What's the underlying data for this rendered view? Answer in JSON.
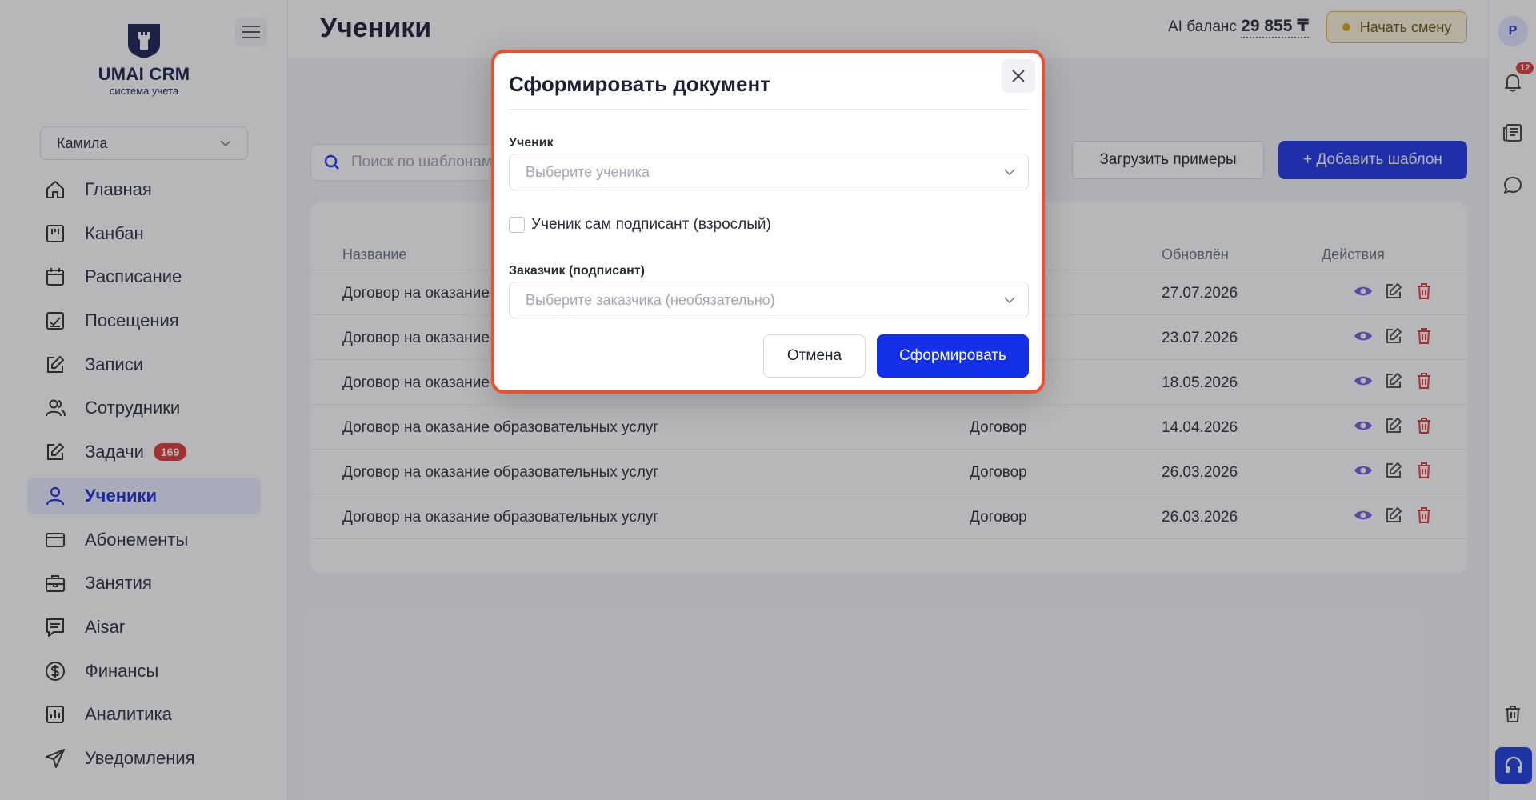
{
  "sidebar": {
    "logo_title": "UMAI CRM",
    "logo_subtitle": "система учета",
    "user": "Камила",
    "items": [
      {
        "label": "Главная",
        "icon": "home-icon"
      },
      {
        "label": "Канбан",
        "icon": "kanban-icon"
      },
      {
        "label": "Расписание",
        "icon": "calendar-icon"
      },
      {
        "label": "Посещения",
        "icon": "chart-check-icon"
      },
      {
        "label": "Записи",
        "icon": "edit-icon"
      },
      {
        "label": "Сотрудники",
        "icon": "users-icon"
      },
      {
        "label": "Задачи",
        "icon": "tasks-icon",
        "badge": "169"
      },
      {
        "label": "Ученики",
        "icon": "user-icon",
        "active": true
      },
      {
        "label": "Абонементы",
        "icon": "card-icon"
      },
      {
        "label": "Занятия",
        "icon": "briefcase-icon"
      },
      {
        "label": "Aisar",
        "icon": "chat-list-icon"
      },
      {
        "label": "Финансы",
        "icon": "dollar-icon"
      },
      {
        "label": "Аналитика",
        "icon": "bar-chart-icon"
      },
      {
        "label": "Уведомления",
        "icon": "send-icon"
      }
    ]
  },
  "header": {
    "title": "Ученики",
    "balance_label": "AI баланс",
    "balance_value": "29 855 ₸",
    "shift_button": "Начать смену"
  },
  "rail": {
    "avatar": "P",
    "notification_count": "12"
  },
  "toolbar": {
    "search_placeholder": "Поиск по шаблонам",
    "load_examples": "Загрузить примеры",
    "add_template": "+ Добавить шаблон"
  },
  "table": {
    "headers": [
      "Название",
      "",
      "Обновлён",
      "Действия"
    ],
    "rows": [
      {
        "name": "Договор на оказание",
        "type": "",
        "updated": "27.07.2026"
      },
      {
        "name": "Договор на оказание",
        "type": "",
        "updated": "23.07.2026"
      },
      {
        "name": "Договор на оказание",
        "type": "",
        "updated": "18.05.2026"
      },
      {
        "name": "Договор на оказание образовательных услуг",
        "type": "Договор",
        "updated": "14.04.2026"
      },
      {
        "name": "Договор на оказание образовательных услуг",
        "type": "Договор",
        "updated": "26.03.2026"
      },
      {
        "name": "Договор на оказание образовательных услуг",
        "type": "Договор",
        "updated": "26.03.2026"
      }
    ]
  },
  "modal": {
    "title": "Сформировать документ",
    "student_label": "Ученик",
    "student_placeholder": "Выберите ученика",
    "self_signer_label": "Ученик сам подписант (взрослый)",
    "customer_label": "Заказчик (подписант)",
    "customer_placeholder": "Выберите заказчика (необязательно)",
    "cancel": "Отмена",
    "submit": "Сформировать"
  },
  "colors": {
    "accent": "#1F35E6",
    "danger": "#E03A3A",
    "modal_border": "#E5522F"
  }
}
